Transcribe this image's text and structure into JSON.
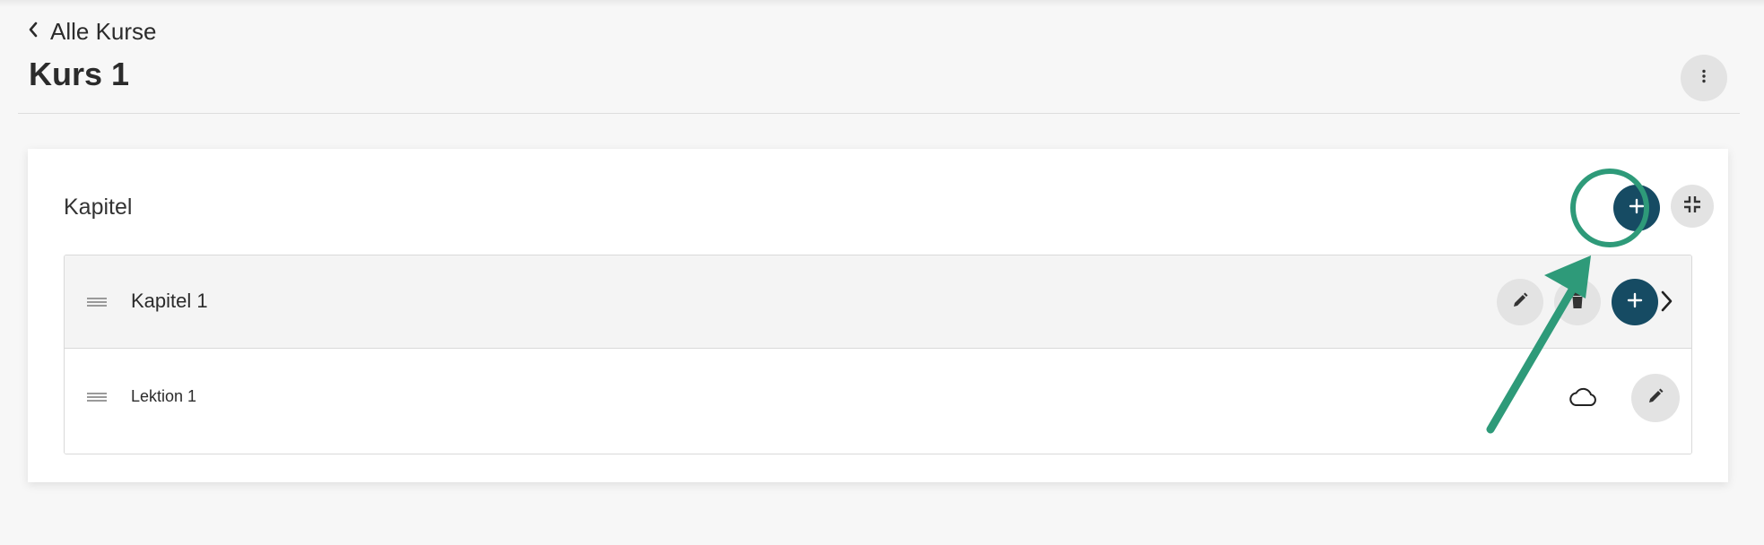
{
  "header": {
    "back_label": "Alle Kurse",
    "title": "Kurs 1"
  },
  "section": {
    "title": "Kapitel"
  },
  "chapters": [
    {
      "label": "Kapitel 1",
      "lessons": [
        {
          "label": "Lektion 1"
        }
      ]
    }
  ],
  "icons": {
    "back": "chevron-left-icon",
    "more": "more-vertical-icon",
    "add": "plus-icon",
    "collapse": "collapse-icon",
    "edit": "pencil-icon",
    "delete": "trash-icon",
    "expand": "chevron-right-icon",
    "status": "cloud-icon",
    "drag": "drag-handle-icon"
  },
  "colors": {
    "primary": "#164b63",
    "secondary_button": "#e3e3e3",
    "annotation": "#2e9a79",
    "background": "#f7f7f7"
  }
}
